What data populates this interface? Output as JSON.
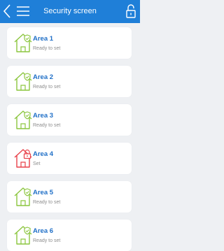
{
  "header": {
    "title": "Security screen",
    "bg_color": "#1f7fd8",
    "back_icon": "chevron-left-icon",
    "menu_icon": "hamburger-menu-icon",
    "lock_icon": "unlocked-padlock-icon"
  },
  "colors": {
    "ready": "#8cc63f",
    "set": "#e8414a",
    "area_name": "#1f6fc7"
  },
  "areas": [
    {
      "name": "Area 1",
      "status": "Ready to set",
      "state": "ready",
      "icon": "house-shield-icon"
    },
    {
      "name": "Area 2",
      "status": "Ready to set",
      "state": "ready",
      "icon": "house-shield-icon"
    },
    {
      "name": "Area 3",
      "status": "Ready to set",
      "state": "ready",
      "icon": "house-shield-icon"
    },
    {
      "name": "Area 4",
      "status": "Set",
      "state": "set",
      "icon": "house-lock-icon"
    },
    {
      "name": "Area 5",
      "status": "Ready to set",
      "state": "ready",
      "icon": "house-shield-icon"
    },
    {
      "name": "Area 6",
      "status": "Ready to set",
      "state": "ready",
      "icon": "house-shield-icon"
    }
  ]
}
